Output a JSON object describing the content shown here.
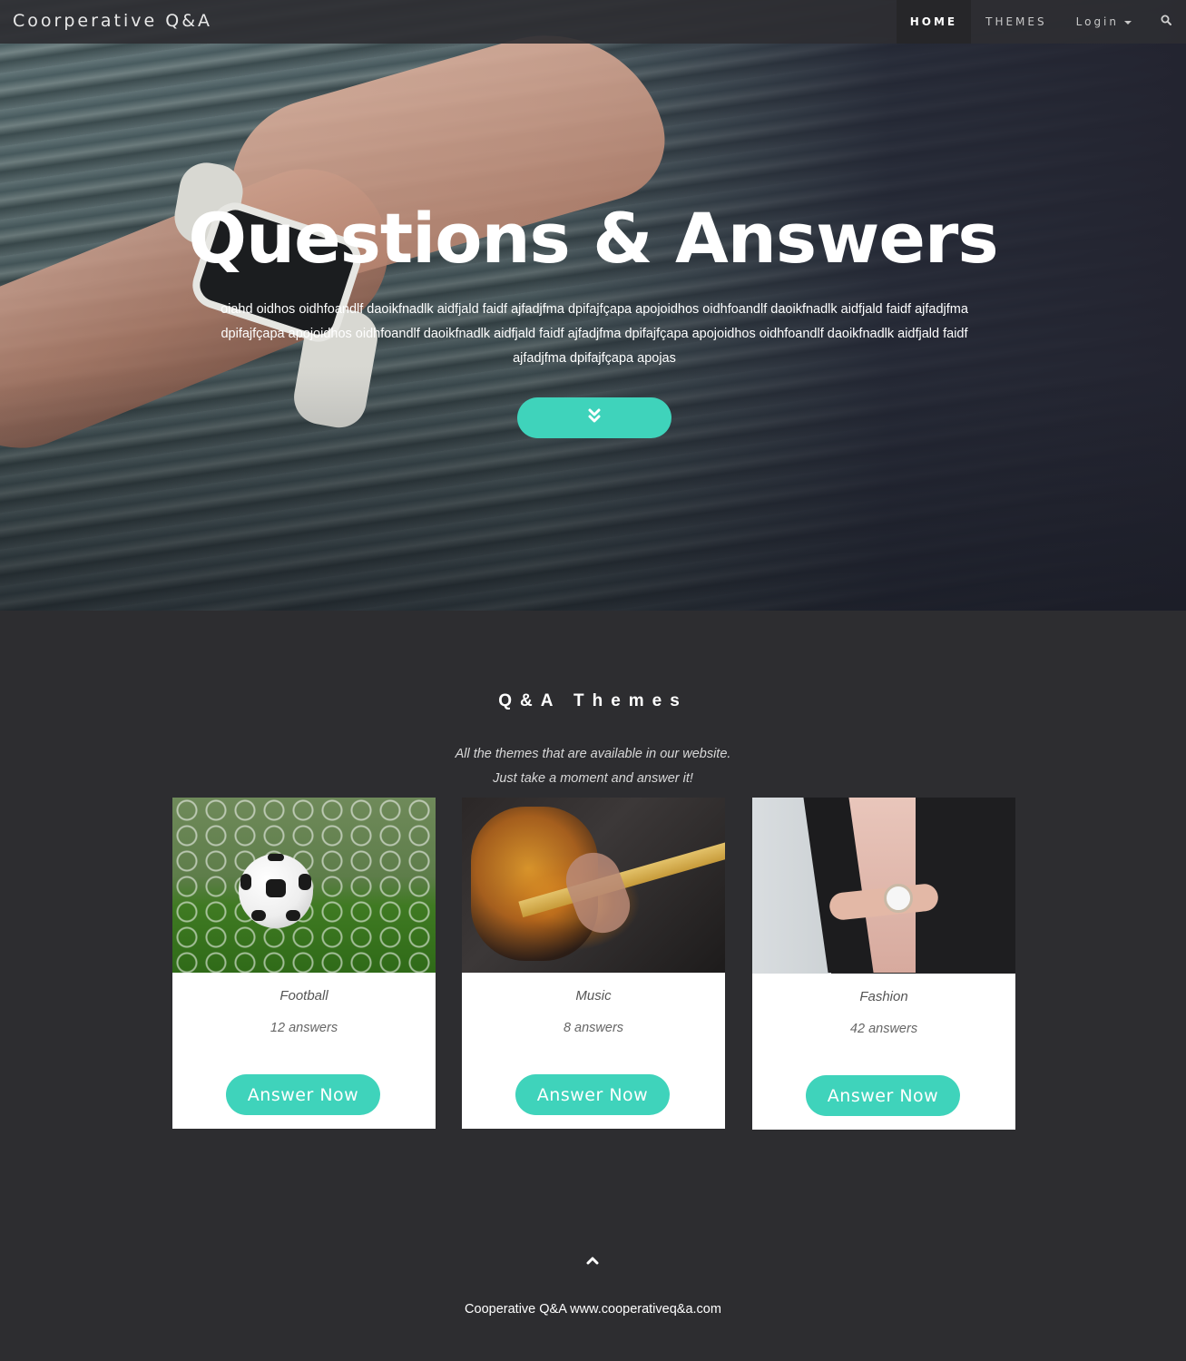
{
  "navbar": {
    "brand": "Coorperative Q&A",
    "links": {
      "home": "HOME",
      "themes": "THEMES",
      "login": "Login"
    },
    "search_icon": "search-icon"
  },
  "hero": {
    "title": "Questions & Answers",
    "text": "oiahd oidhos oidhfoandlf daoikfnadlk aidfjald faidf ajfadjfma dpifajfçapa apojoidhos oidhfoandlf daoikfnadlk aidfjald faidf ajfadjfma dpifajfçapa apojoidhos oidhfoandlf daoikfnadlk aidfjald faidf ajfadjfma dpifajfçapa apojoidhos oidhfoandlf daoikfnadlk aidfjald faidf ajfadjfma dpifajfçapa apojas",
    "scroll_icon": "double-chevron-down-icon"
  },
  "themes_section": {
    "title": "Q&A Themes",
    "subtitle_line1": "All the themes that are available in our website.",
    "subtitle_line2": "Just take a moment and answer it!"
  },
  "cards": [
    {
      "name": "Football",
      "answers": "12 answers",
      "button": "Answer Now"
    },
    {
      "name": "Music",
      "answers": "8 answers",
      "button": "Answer Now"
    },
    {
      "name": "Fashion",
      "answers": "42 answers",
      "button": "Answer Now"
    }
  ],
  "footer": {
    "text": "Cooperative Q&A www.cooperativeq&a.com",
    "to_top_icon": "chevron-up-icon"
  },
  "colors": {
    "accent": "#3fd3bb",
    "background": "#2d2d30"
  }
}
